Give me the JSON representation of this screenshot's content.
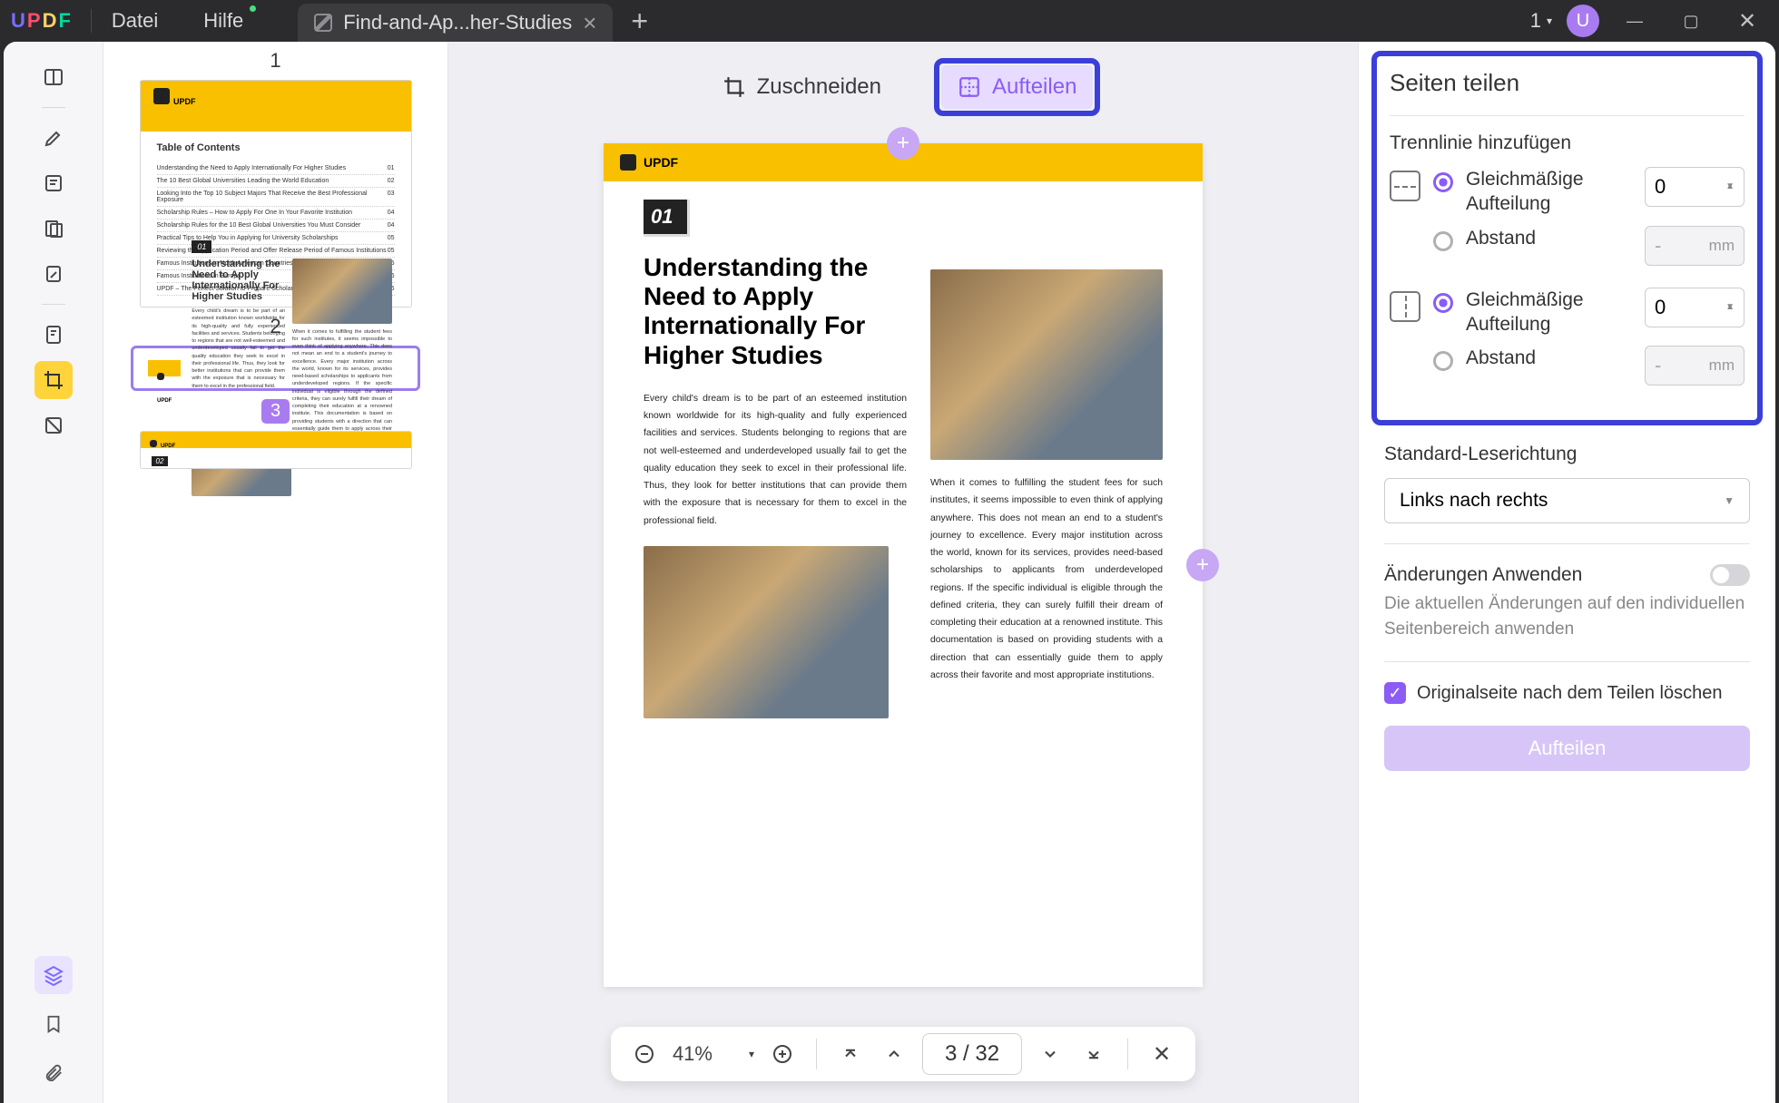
{
  "titlebar": {
    "logo": "UPDF",
    "menu_file": "Datei",
    "menu_help": "Hilfe",
    "tab_title": "Find-and-Ap...her-Studies",
    "tab_count": "1",
    "avatar_letter": "U"
  },
  "thumbnails": {
    "p1": "1",
    "p2": "2",
    "p3": "3",
    "toc_title": "Table of Contents",
    "toc": [
      {
        "t": "Understanding the Need to Apply Internationally For Higher Studies",
        "p": "01"
      },
      {
        "t": "The 10 Best Global Universities Leading the World Education",
        "p": "02"
      },
      {
        "t": "Looking Into the Top 10 Subject Majors That Receive the Best Professional Exposure",
        "p": "03"
      },
      {
        "t": "Scholarship Rules – How to Apply For One In Your Favorite Institution",
        "p": "04"
      },
      {
        "t": "Scholarship Rules for the 10 Best Global Universities You Must Consider",
        "p": "04"
      },
      {
        "t": "Practical Tips to Help You in Applying for University Scholarships",
        "p": "05"
      },
      {
        "t": "Reviewing the Application Period and Offer Release Period of Famous Institutions",
        "p": "05"
      },
      {
        "t": "Famous Institutions in North American Countries",
        "p": "05"
      },
      {
        "t": "Famous Institutions in Europe",
        "p": "06"
      },
      {
        "t": "UPDF – The Perfect Solution to Prepare Scholarship Applications for Students",
        "p": "06"
      }
    ]
  },
  "toptools": {
    "crop": "Zuschneiden",
    "split": "Aufteilen"
  },
  "page": {
    "brand": "UPDF",
    "num": "01",
    "title": "Understanding the Need to Apply Internationally For Higher Studies",
    "para1": "Every child's dream is to be part of an esteemed institution known worldwide for its high-quality and fully experienced facilities and services. Students belonging to regions that are not well-esteemed and underdeveloped usually fail to get the quality education they seek to excel in their professional life. Thus, they look for better institutions that can provide them with the exposure that is necessary for them to excel in the professional field.",
    "para2": "When it comes to fulfilling the student fees for such institutes, it seems impossible to even think of applying anywhere. This does not mean an end to a student's journey to excellence. Every major institution across the world, known for its services, provides need-based scholarships to applicants from underdeveloped regions. If the specific individual is eligible through the defined criteria, they can surely fulfill their dream of completing their education at a renowned institute. This documentation is based on providing students with a direction that can essentially guide them to apply across their favorite and most appropriate institutions."
  },
  "bottombar": {
    "zoom": "41%",
    "page": "3 / 32"
  },
  "panel": {
    "title": "Seiten teilen",
    "add_divider": "Trennlinie hinzufügen",
    "even": "Gleichmäßige Aufteilung",
    "spacing": "Abstand",
    "val0": "0",
    "dash": "-",
    "mm": "mm",
    "reading_dir": "Standard-Leserichtung",
    "ltr": "Links nach rechts",
    "apply": "Änderungen Anwenden",
    "apply_desc": "Die aktuellen Änderungen auf den individuellen Seitenbereich anwenden",
    "delete_orig": "Originalseite nach dem Teilen löschen",
    "split_btn": "Aufteilen"
  }
}
